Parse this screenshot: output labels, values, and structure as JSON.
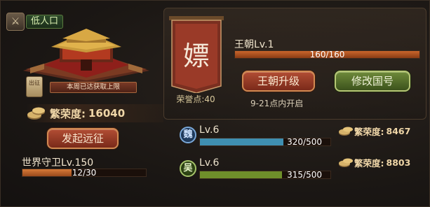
{
  "population_badge": {
    "text": "低人口"
  },
  "palace": {
    "weekly_status": "本周已达获取上限",
    "seal_text": "出征"
  },
  "prosperity": {
    "label": "繁荣度:",
    "value": "16040"
  },
  "expedition_button": "发起远征",
  "world_guard": {
    "label": "世界守卫Lv.150",
    "progress_text": "12/30",
    "progress": 0.4
  },
  "banner": {
    "glyph": "嫖",
    "honor": "荣誉点:40"
  },
  "dynasty": {
    "label": "王朝Lv.1",
    "progress_text": "160/160",
    "progress": 1.0,
    "upgrade_button": "王朝升级",
    "rename_button": "修改国号",
    "open_time": "9-21点内开启"
  },
  "kingdoms": [
    {
      "icon": "魏",
      "level": "Lv.6",
      "progress_text": "320/500",
      "progress": 0.64,
      "prosperity_label": "繁荣度:",
      "prosperity_value": "8467",
      "bar_color": "#3f8fb1"
    },
    {
      "icon": "吴",
      "level": "Lv.6",
      "progress_text": "315/500",
      "progress": 0.63,
      "prosperity_label": "繁荣度:",
      "prosperity_value": "8803",
      "bar_color": "#6f8f2a"
    }
  ],
  "colors": {
    "accent_red": "#b14d34",
    "accent_green": "#6e8a3a",
    "bar_orange": "#c4682e"
  }
}
